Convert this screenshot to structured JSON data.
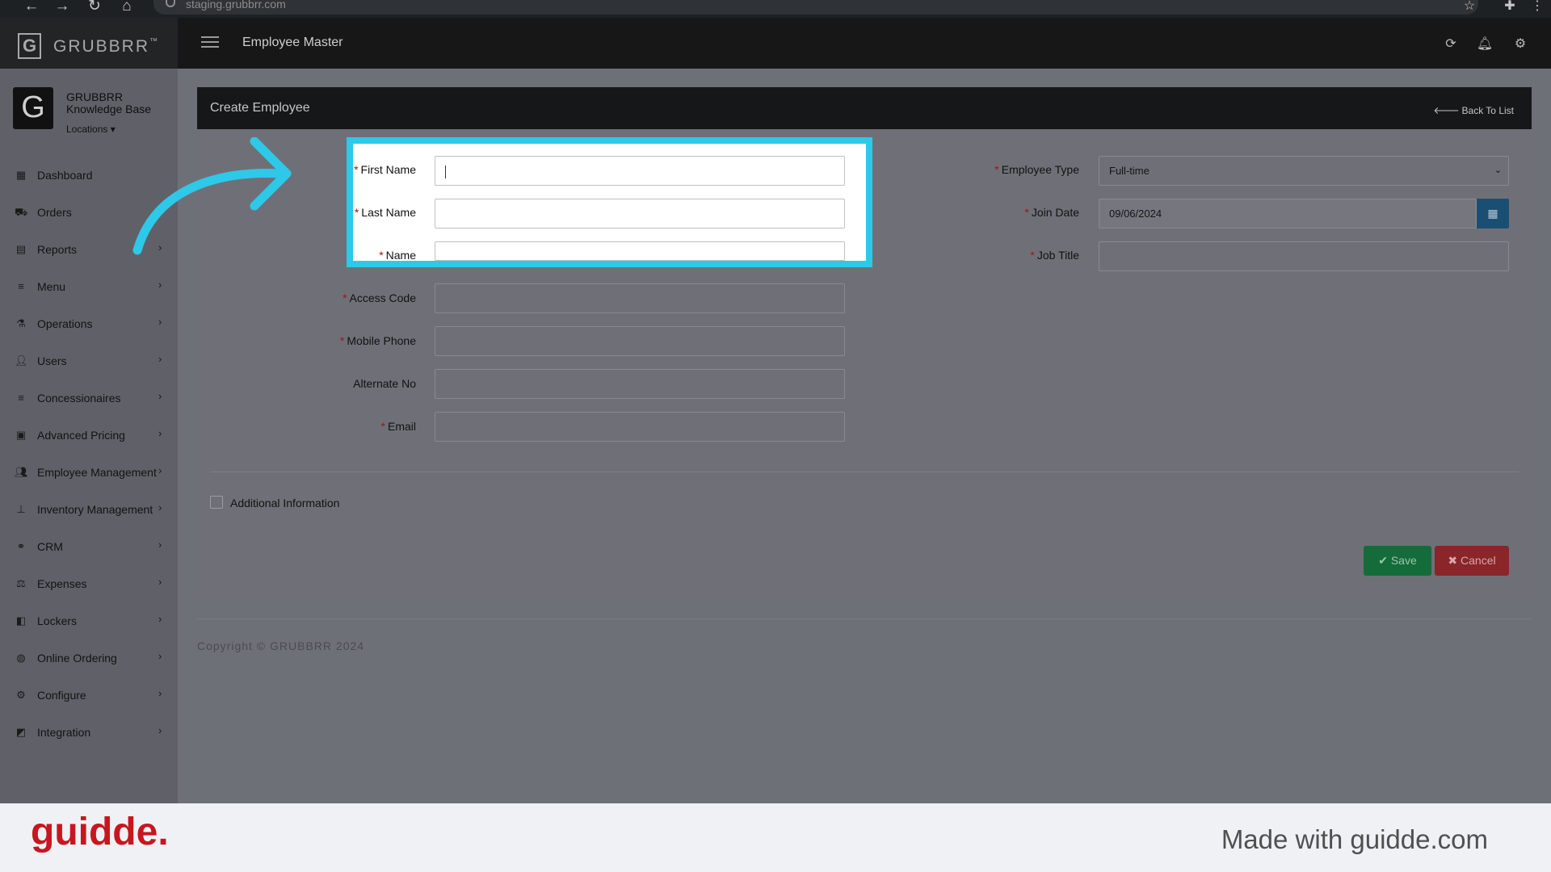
{
  "browser": {
    "url": "staging.grubbrr.com"
  },
  "app": {
    "brand": "GRUBBRR",
    "brand_tm": "™",
    "page_heading": "Employee Master"
  },
  "sidebar": {
    "profile_name": "GRUBBRR Knowledge Base",
    "locations_label": "Locations",
    "items": [
      {
        "label": "Dashboard",
        "icon": "dashboard-icon",
        "has_submenu": false
      },
      {
        "label": "Orders",
        "icon": "cart-icon",
        "has_submenu": false
      },
      {
        "label": "Reports",
        "icon": "report-icon",
        "has_submenu": true
      },
      {
        "label": "Menu",
        "icon": "list-icon",
        "has_submenu": true
      },
      {
        "label": "Operations",
        "icon": "flask-icon",
        "has_submenu": true
      },
      {
        "label": "Users",
        "icon": "user-add-icon",
        "has_submenu": true
      },
      {
        "label": "Concessionaires",
        "icon": "list-icon",
        "has_submenu": true
      },
      {
        "label": "Advanced Pricing",
        "icon": "money-icon",
        "has_submenu": true
      },
      {
        "label": "Employee Management",
        "icon": "users-icon",
        "has_submenu": true
      },
      {
        "label": "Inventory Management",
        "icon": "sitemap-icon",
        "has_submenu": true
      },
      {
        "label": "CRM",
        "icon": "link-icon",
        "has_submenu": true
      },
      {
        "label": "Expenses",
        "icon": "scale-icon",
        "has_submenu": true
      },
      {
        "label": "Lockers",
        "icon": "locker-icon",
        "has_submenu": true
      },
      {
        "label": "Online Ordering",
        "icon": "globe-icon",
        "has_submenu": true
      },
      {
        "label": "Configure",
        "icon": "gear-icon",
        "has_submenu": true
      },
      {
        "label": "Integration",
        "icon": "integration-icon",
        "has_submenu": true
      }
    ]
  },
  "form": {
    "title": "Create Employee",
    "back_label": "Back To List",
    "fields": {
      "first_name": {
        "label": "First Name",
        "value": "",
        "required": true
      },
      "last_name": {
        "label": "Last Name",
        "value": "",
        "required": true
      },
      "name": {
        "label": "Name",
        "value": "",
        "required": true
      },
      "access_code": {
        "label": "Access Code",
        "value": "",
        "required": true
      },
      "mobile_phone": {
        "label": "Mobile Phone",
        "value": "",
        "required": true
      },
      "alternate_no": {
        "label": "Alternate No",
        "value": "",
        "required": false
      },
      "email": {
        "label": "Email",
        "value": "",
        "required": true
      },
      "employee_type": {
        "label": "Employee Type",
        "value": "Full-time",
        "required": true
      },
      "join_date": {
        "label": "Join Date",
        "value": "09/06/2024",
        "required": true
      },
      "job_title": {
        "label": "Job Title",
        "value": "",
        "required": true
      }
    },
    "additional_info_label": "Additional Information",
    "save_label": "Save",
    "cancel_label": "Cancel"
  },
  "footer": {
    "copyright": "Copyright © GRUBBRR 2024"
  },
  "guidde": {
    "logo": "guidde.",
    "made_with": "Made with guidde.com"
  },
  "colors": {
    "highlight": "#2ec8e9",
    "save": "#136c3a",
    "cancel": "#8a2529",
    "required": "#a21414",
    "guidde_brand": "#c81620"
  }
}
